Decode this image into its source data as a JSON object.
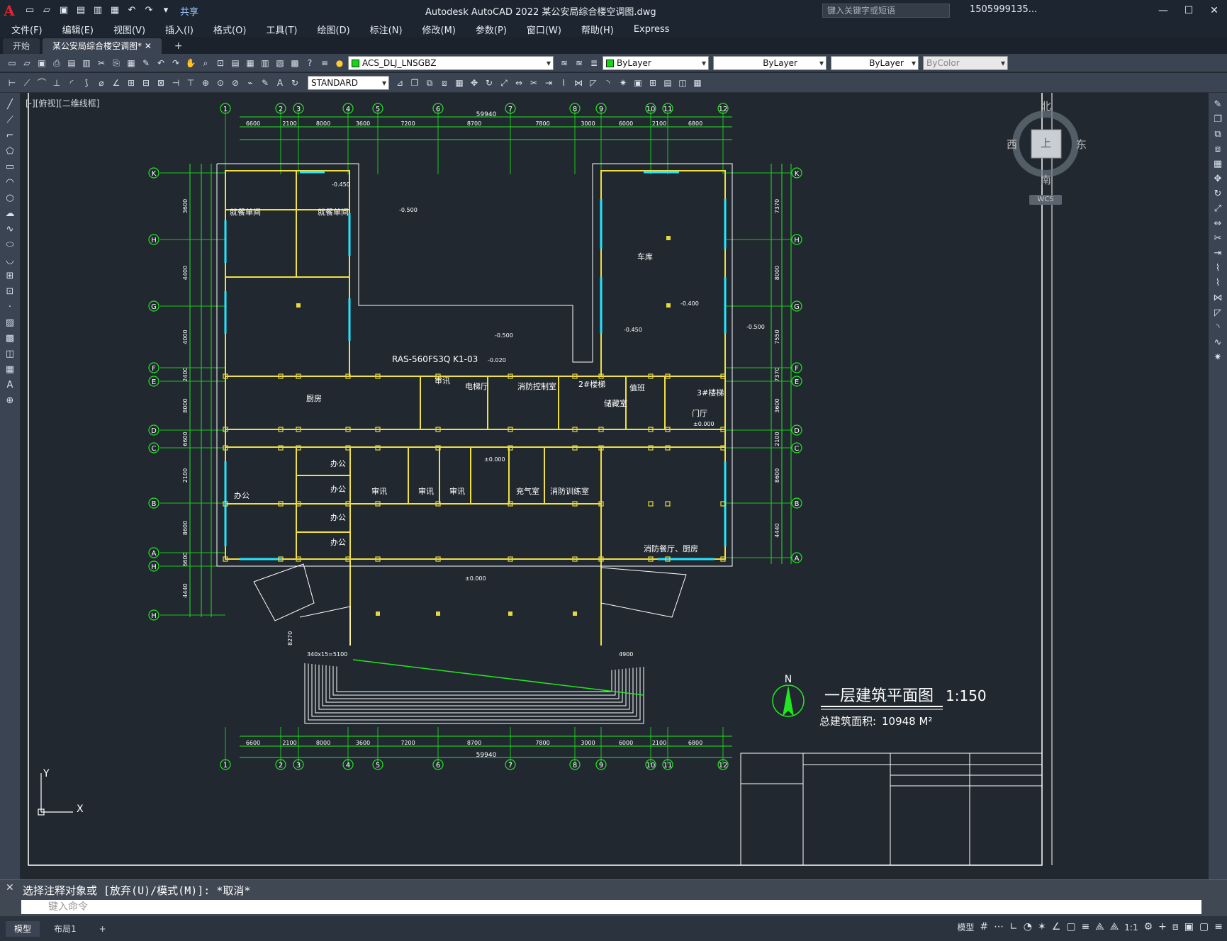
{
  "app": {
    "title": "Autodesk AutoCAD 2022    某公安局综合楼空调图.dwg",
    "search_placeholder": "键入关键字或短语",
    "user": "1505999135...",
    "share": "共享"
  },
  "menu": [
    "文件(F)",
    "编辑(E)",
    "视图(V)",
    "插入(I)",
    "格式(O)",
    "工具(T)",
    "绘图(D)",
    "标注(N)",
    "修改(M)",
    "参数(P)",
    "窗口(W)",
    "帮助(H)",
    "Express"
  ],
  "tabs": [
    {
      "label": "开始"
    },
    {
      "label": "某公安局综合楼空调图*"
    }
  ],
  "toolbar": {
    "layer": "ACS_DLJ_LNSGBZ",
    "color": "ByLayer",
    "linetype": "ByLayer",
    "lineweight": "ByLayer",
    "plotstyle": "ByColor",
    "textstyle": "STANDARD"
  },
  "viewport_label": "[-][俯视][二维线框]",
  "viewcube": {
    "north": "北",
    "south": "南",
    "east": "东",
    "west": "西",
    "top": "上",
    "wcs": "WCS"
  },
  "drawing": {
    "title": "一层建筑平面图",
    "scale": "1:150",
    "area_label": "总建筑面积:",
    "area_value": "10948 M²",
    "north": "N",
    "cols": [
      "1",
      "2",
      "3",
      "4",
      "5",
      "6",
      "7",
      "8",
      "9",
      "10",
      "11",
      "12"
    ],
    "rows_left": [
      "K",
      "H",
      "G",
      "F",
      "E",
      "D",
      "C",
      "B",
      "A",
      "H",
      "H"
    ],
    "rows_right": [
      "K",
      "H",
      "G",
      "F",
      "E",
      "D",
      "C",
      "B",
      "A"
    ],
    "dim_top1": [
      "6600",
      "2100",
      "8000",
      "3600",
      "7200",
      "8700",
      "7800",
      "3000",
      "6000",
      "2100",
      "6800"
    ],
    "dim_total": "59940",
    "dim_left": [
      "3600",
      "4400",
      "4000",
      "2400",
      "8000",
      "6600",
      "2100",
      "8600",
      "6600",
      "4440"
    ],
    "dim_right": [
      "7370",
      "8000",
      "7550",
      "7370",
      "3600",
      "2100",
      "8600",
      "4440"
    ],
    "rooms": [
      "就餐单间",
      "就餐单间",
      "车库",
      "厨房",
      "审讯",
      "电梯厅",
      "消防控制室",
      "储藏室",
      "值班",
      "门厅",
      "3#楼梯",
      "2#楼梯",
      "办公",
      "办公",
      "办公",
      "办公",
      "办公",
      "审讯",
      "审讯",
      "审讯",
      "充气室",
      "消防训练室",
      "消防餐厅、厨房"
    ],
    "unit_label": "RAS-560FS3Q  K1-03",
    "elev": [
      "-0.500",
      "-0.450",
      "-0.400",
      "-0.450",
      "-0.500",
      "±0.000",
      "±0.000",
      "±0.000",
      "-0.020",
      "-0.500"
    ],
    "stairs_note": "340x15=5100",
    "dim_4900": "4900",
    "dim_8270": "8270"
  },
  "command": {
    "history": "选择注释对象或 [放弃(U)/模式(M)]: *取消*",
    "placeholder": "键入命令"
  },
  "status": {
    "tabs": [
      "模型",
      "布局1"
    ],
    "model": "模型",
    "scale": "1:1"
  }
}
